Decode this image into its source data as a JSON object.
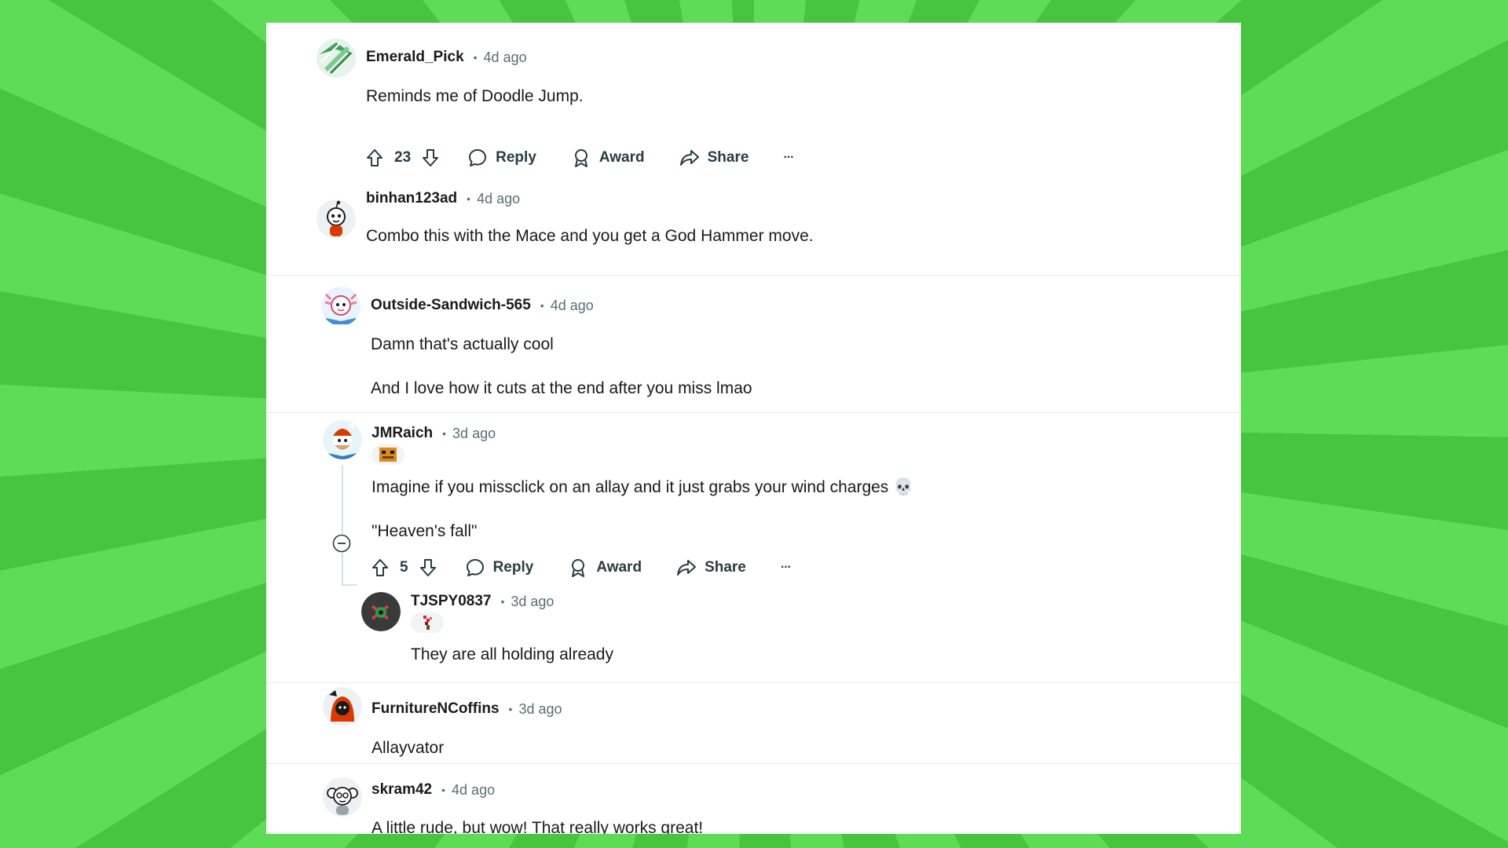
{
  "comments": [
    {
      "username": "Emerald_Pick",
      "separator": "•",
      "time": "4d ago",
      "lines": [
        "Reminds me of Doodle Jump."
      ],
      "votes": "23",
      "actions": {
        "reply": "Reply",
        "award": "Award",
        "share": "Share",
        "more": "···"
      }
    },
    {
      "username": "binhan123ad",
      "separator": "•",
      "time": "4d ago",
      "lines": [
        "Combo this with the Mace and you get a God Hammer move."
      ]
    },
    {
      "username": "Outside-Sandwich-565",
      "separator": "•",
      "time": "4d ago",
      "lines": [
        "Damn that's actually cool",
        "And I love how it cuts at the end after you miss lmao"
      ]
    },
    {
      "username": "JMRaich",
      "separator": "•",
      "time": "3d ago",
      "lines": [
        "Imagine if you missclick on an allay and it just grabs your wind charges 💀",
        "\"Heaven's fall\""
      ],
      "votes": "5",
      "actions": {
        "reply": "Reply",
        "award": "Award",
        "share": "Share",
        "more": "···"
      }
    },
    {
      "username": "TJSPY0837",
      "separator": "•",
      "time": "3d ago",
      "lines": [
        "They are all holding already"
      ]
    },
    {
      "username": "FurnitureNCoffins",
      "separator": "•",
      "time": "3d ago",
      "lines": [
        "Allayvator"
      ]
    },
    {
      "username": "skram42",
      "separator": "•",
      "time": "4d ago",
      "lines": [
        "A little rude, but wow! That really works great!"
      ]
    }
  ],
  "colors": {
    "background": "#55d64c",
    "card": "#ffffff",
    "text": "#1a1a1b",
    "meta": "#576f76"
  },
  "icons": [
    "upvote-icon",
    "downvote-icon",
    "reply-icon",
    "award-icon",
    "share-icon",
    "more-icon",
    "collapse-icon"
  ]
}
